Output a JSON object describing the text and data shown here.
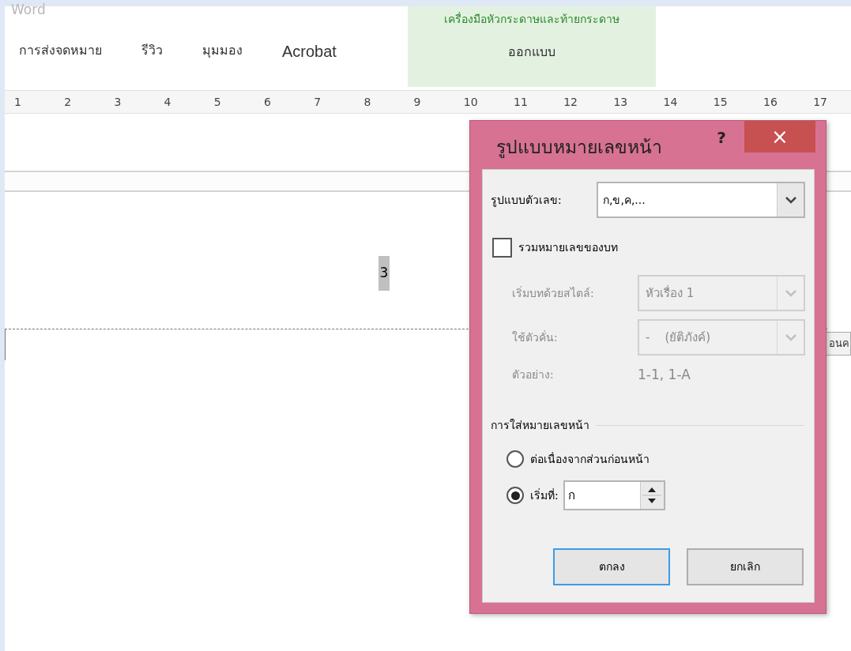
{
  "app": {
    "title": "Word",
    "contextual_group": "เครื่องมือหัวกระดาษและท้ายกระดาษ"
  },
  "tabs": [
    {
      "label": "การส่งจดหมาย",
      "selected": false
    },
    {
      "label": "รีวิว",
      "selected": false
    },
    {
      "label": "มุมมอง",
      "selected": false
    },
    {
      "label": "Acrobat",
      "selected": false
    },
    {
      "label": "ออกแบบ",
      "selected": true
    }
  ],
  "ruler": [
    "1",
    "2",
    "3",
    "4",
    "5",
    "6",
    "7",
    "8",
    "9",
    "10",
    "11",
    "12",
    "13",
    "14",
    "15",
    "16",
    "17"
  ],
  "document": {
    "page_number": "3",
    "footer_tag": "อนค"
  },
  "dialog": {
    "title": "รูปแบบหมายเลขหน้า",
    "help": "?",
    "close": "×",
    "number_format": {
      "label": "รูปแบบตัวเลข:",
      "value": "ก,ข,ค,..."
    },
    "include_chapter": {
      "label": "รวมหมายเลขของบท",
      "checked": false
    },
    "chapter_fields": [
      {
        "label": "เริ่มบทด้วยสไตล์:",
        "value": "หัวเรื่อง 1",
        "disabled": true
      },
      {
        "label": "ใช้ตัวคั่น:",
        "value": "-    (ยัติภังค์)",
        "disabled": true
      }
    ],
    "example": {
      "label": "ตัวอย่าง:",
      "value": "1-1, 1-A",
      "disabled": true
    },
    "section": "การใส่หมายเลขหน้า",
    "options": [
      {
        "label": "ต่อเนื่องจากส่วนก่อนหน้า",
        "selected": false
      },
      {
        "label": "เริ่มที่:",
        "selected": true,
        "value": "ก"
      }
    ],
    "buttons": [
      {
        "label": "ตกลง",
        "default": true
      },
      {
        "label": "ยกเลิก",
        "default": false
      }
    ]
  }
}
